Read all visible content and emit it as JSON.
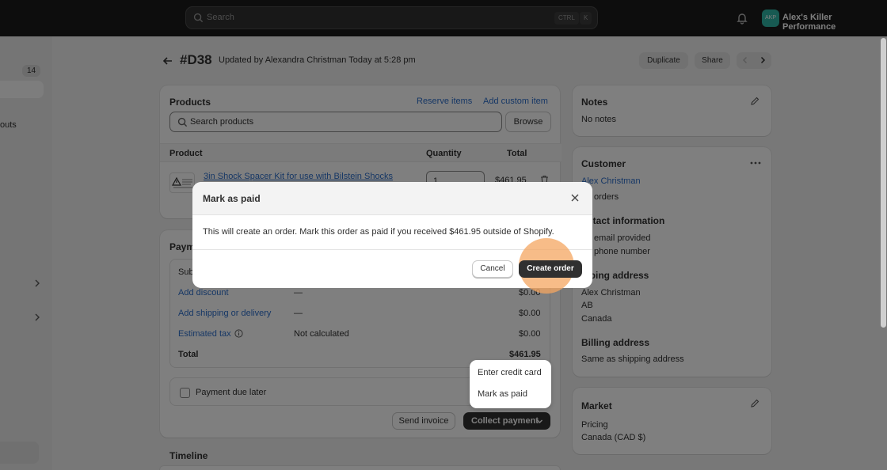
{
  "topbar": {
    "search_placeholder": "Search",
    "kbd_ctrl": "CTRL",
    "kbd_k": "K",
    "store_initials": "AKP",
    "store_name": "Alex's Killer Performance"
  },
  "sidebar": {
    "badge": "14",
    "partial_item": "outs"
  },
  "header": {
    "order_id": "#D38",
    "updated": "Updated by Alexandra Christman Today at 5:28 pm",
    "duplicate": "Duplicate",
    "share": "Share"
  },
  "products": {
    "title": "Products",
    "reserve": "Reserve items",
    "add_custom": "Add custom item",
    "search_placeholder": "Search products",
    "browse": "Browse",
    "col_product": "Product",
    "col_quantity": "Quantity",
    "col_total": "Total",
    "item_name": "3in Shock Spacer Kit for use with Bilstein Shocks",
    "item_qty": "1",
    "item_total": "$461.95"
  },
  "payment": {
    "title_partial": "Paym",
    "subtotal_partial": "Sub",
    "add_discount": "Add discount",
    "discount_dash": "—",
    "discount_amount": "$0.00",
    "add_shipping": "Add shipping or delivery",
    "shipping_dash": "—",
    "shipping_amount": "$0.00",
    "estimated_tax": "Estimated tax",
    "tax_status": "Not calculated",
    "tax_amount": "$0.00",
    "total_label": "Total",
    "total_amount": "$461.95",
    "payment_due_later": "Payment due later",
    "send_invoice": "Send invoice",
    "collect_payment": "Collect payment",
    "dropdown": [
      "Enter credit card",
      "Mark as paid"
    ]
  },
  "timeline": {
    "title": "Timeline"
  },
  "notes": {
    "title": "Notes",
    "body": "No notes"
  },
  "customer": {
    "title": "Customer",
    "name": "Alex Christman",
    "orders": "orders",
    "contact_title": "ontact information",
    "email": "email provided",
    "phone": "phone number",
    "shipping_title": "ipping address",
    "ship_name": "Alex Christman",
    "ship_region": "AB",
    "ship_country": "Canada",
    "billing_title": "Billing address",
    "billing_body": "Same as shipping address"
  },
  "market": {
    "title": "Market",
    "pricing": "Pricing",
    "currency": "Canada (CAD $)"
  },
  "modal": {
    "title": "Mark as paid",
    "body": "This will create an order. Mark this order as paid if you received $461.95 outside of Shopify.",
    "cancel": "Cancel",
    "create": "Create order"
  }
}
